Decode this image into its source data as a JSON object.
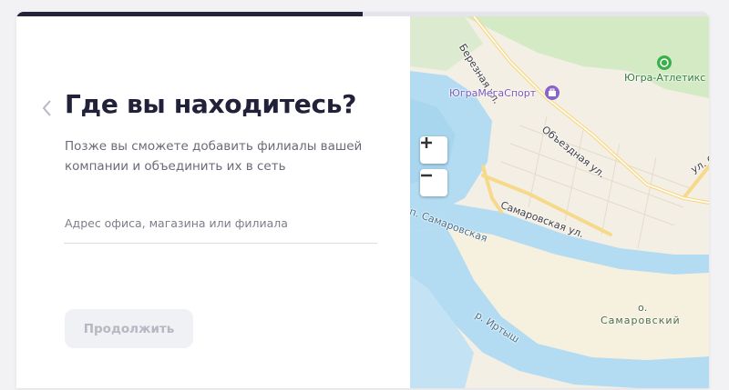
{
  "progress": {
    "fraction": 0.5
  },
  "form": {
    "title": "Где вы находитесь?",
    "subtitle": "Позже вы сможете добавить филиалы вашей компании и объединить их в сеть",
    "address_placeholder": "Адрес офиса, магазина или филиала",
    "address_value": "",
    "continue_label": "Продолжить"
  },
  "map": {
    "zoom_in_icon": "plus-icon",
    "zoom_out_icon": "minus-icon",
    "labels": {
      "street_bereznaya": "Березная ул.",
      "ugramegasport": "ЮграМегаСпорт",
      "ugra_atletiks": "Югра-Атлетикс",
      "obezdnaya": "Объездная ул.",
      "street_right": "ул. О",
      "samarovskaya_street": "Самаровская ул.",
      "samarovskaya_channel": "п. Самаровская",
      "irtysh": "р. Иртыш",
      "island_o": "о.",
      "island_name": "Самаровский"
    },
    "colors": {
      "water": "#b3dcf2",
      "forest": "#cfe7c2",
      "land": "#f4efe4",
      "road": "#f6d98a",
      "poi": "#8a62c8",
      "poi_green": "#3bb04a"
    }
  }
}
